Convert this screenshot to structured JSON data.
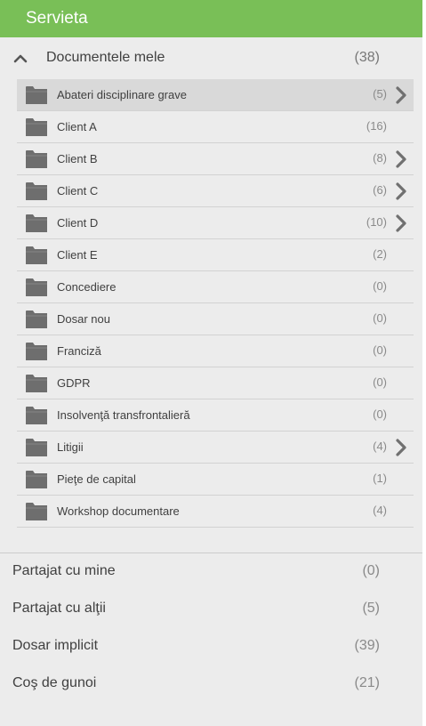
{
  "header": {
    "title": "Servieta"
  },
  "my_documents": {
    "label": "Documentele mele",
    "count": "(38)",
    "folders": [
      {
        "name": "Abateri disciplinare grave",
        "count": "(5)",
        "has_children": true,
        "selected": true
      },
      {
        "name": "Client A",
        "count": "(16)",
        "has_children": false,
        "selected": false
      },
      {
        "name": "Client B",
        "count": "(8)",
        "has_children": true,
        "selected": false
      },
      {
        "name": "Client C",
        "count": "(6)",
        "has_children": true,
        "selected": false
      },
      {
        "name": "Client D",
        "count": "(10)",
        "has_children": true,
        "selected": false
      },
      {
        "name": "Client E",
        "count": "(2)",
        "has_children": false,
        "selected": false
      },
      {
        "name": "Concediere",
        "count": "(0)",
        "has_children": false,
        "selected": false
      },
      {
        "name": "Dosar nou",
        "count": "(0)",
        "has_children": false,
        "selected": false
      },
      {
        "name": "Franciză",
        "count": "(0)",
        "has_children": false,
        "selected": false
      },
      {
        "name": "GDPR",
        "count": "(0)",
        "has_children": false,
        "selected": false
      },
      {
        "name": "Insolvenţă transfrontalieră",
        "count": "(0)",
        "has_children": false,
        "selected": false
      },
      {
        "name": "Litigii",
        "count": "(4)",
        "has_children": true,
        "selected": false
      },
      {
        "name": "Pieţe de capital",
        "count": "(1)",
        "has_children": false,
        "selected": false
      },
      {
        "name": "Workshop documentare",
        "count": "(4)",
        "has_children": false,
        "selected": false
      }
    ]
  },
  "bottom_items": [
    {
      "label": "Partajat cu mine",
      "count": "(0)"
    },
    {
      "label": "Partajat cu alţii",
      "count": "(5)"
    },
    {
      "label": "Dosar implicit",
      "count": "(39)"
    },
    {
      "label": "Coş de gunoi",
      "count": "(21)"
    }
  ],
  "icons": {
    "collapse": "chevron-up-icon",
    "folder": "folder-icon",
    "expand": "chevron-right-icon"
  },
  "colors": {
    "header_bg": "#79bf57",
    "panel_bg": "#ececec",
    "selected_row_bg": "#d9d9d9",
    "folder_icon": "#6e6e6e",
    "arrow": "#707070"
  }
}
